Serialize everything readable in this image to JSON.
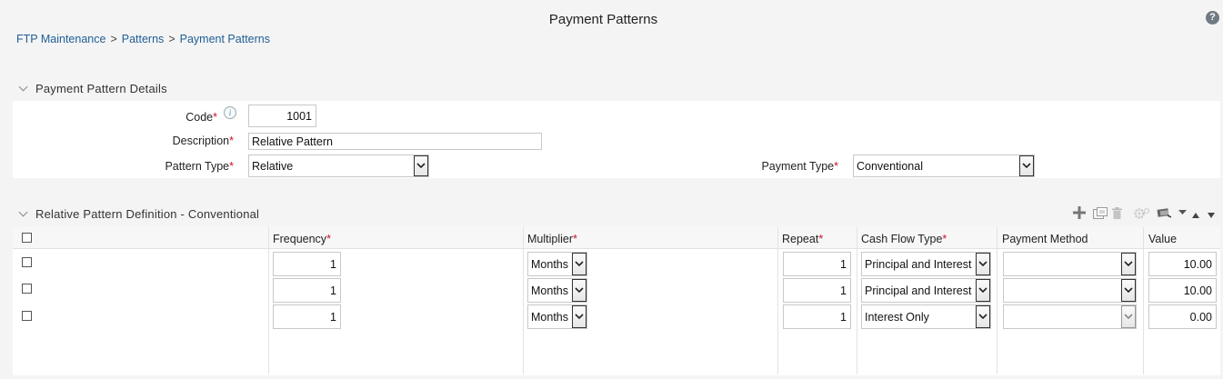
{
  "page": {
    "title": "Payment Patterns",
    "help_glyph": "?",
    "breadcrumb": {
      "items": [
        "FTP Maintenance",
        "Patterns",
        "Payment Patterns"
      ],
      "separator": ">"
    }
  },
  "details": {
    "section_title": "Payment Pattern Details",
    "code": {
      "label": "Code",
      "value": "1001",
      "info_glyph": "i"
    },
    "description": {
      "label": "Description",
      "value": "Relative Pattern"
    },
    "pattern_type": {
      "label": "Pattern Type",
      "value": "Relative"
    },
    "payment_type": {
      "label": "Payment Type",
      "value": "Conventional"
    },
    "required_marker": "*"
  },
  "definition": {
    "section_title": "Relative Pattern Definition - Conventional",
    "toolbar": {
      "icons": [
        "add-icon",
        "copy-icon",
        "delete-icon",
        "settings-icon",
        "view-icon",
        "dropdown-icon",
        "move-up-icon",
        "move-down-icon"
      ]
    },
    "columns": {
      "frequency": "Frequency",
      "multiplier": "Multiplier",
      "repeat": "Repeat",
      "cash_flow_type": "Cash Flow Type",
      "payment_method": "Payment Method",
      "value": "Value"
    },
    "required_columns": [
      "frequency",
      "multiplier",
      "repeat",
      "cash_flow_type"
    ],
    "rows": [
      {
        "frequency": "1",
        "multiplier": "Months",
        "repeat": "1",
        "cash_flow_type": "Principal and Interest",
        "payment_method": "",
        "value": "10.00"
      },
      {
        "frequency": "1",
        "multiplier": "Months",
        "repeat": "1",
        "cash_flow_type": "Principal and Interest",
        "payment_method": "",
        "value": "10.00"
      },
      {
        "frequency": "1",
        "multiplier": "Months",
        "repeat": "1",
        "cash_flow_type": "Interest Only",
        "payment_method": "",
        "value": "0.00"
      }
    ]
  },
  "colors": {
    "link": "#1f5e96",
    "required": "#c8102e",
    "panel_bg": "#ffffff",
    "page_bg": "#f4f4f4"
  }
}
